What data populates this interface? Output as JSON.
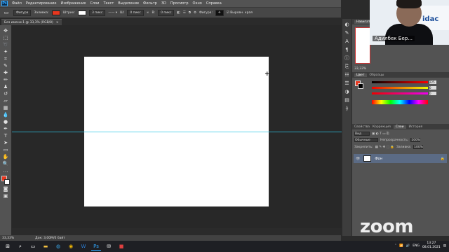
{
  "app": {
    "logo_text": "Ps",
    "menu": [
      "Файл",
      "Редактирование",
      "Изображение",
      "Слои",
      "Текст",
      "Выделение",
      "Фильтр",
      "3D",
      "Просмотр",
      "Окно",
      "Справка"
    ]
  },
  "options": {
    "shape_mode": "Фигура",
    "fill_label": "Заливка:",
    "stroke_label": "Штрих:",
    "stroke_width": "3 пикс",
    "w_label": "Ш:",
    "w_value": "0 пикс",
    "h_label": "В:",
    "h_value": "0 пикс",
    "align_edges": "Выровн. края",
    "fill_color": "#e8371f",
    "stroke_color": "#ffffff"
  },
  "document": {
    "tab_title": "Без имени-1 @ 33,3% (RGB/8)",
    "close": "×"
  },
  "status": {
    "zoom": "33,33%",
    "doc_info": "Док: 3,00M/0 байт"
  },
  "navigator": {
    "tab": "Навигатор",
    "zoom": "33,33%"
  },
  "color_panel": {
    "tabs": [
      "Цвет",
      "Образцы"
    ],
    "r": "225",
    "g": "0",
    "b": "0",
    "fg_color": "#e8371f"
  },
  "layers_panel": {
    "tabs": [
      "Свойства",
      "Коррекция",
      "Слои",
      "История"
    ],
    "kind_label": "Вид",
    "blend_mode": "Обычные",
    "opacity_label": "Непрозрачность:",
    "opacity_value": "100%",
    "lock_label": "Закрепить:",
    "fill_label": "Заливка:",
    "fill_value": "100%",
    "layer_name": "Фон",
    "lock_icon": "lock-icon"
  },
  "webcam": {
    "participant_name": "Адилбек Бер...",
    "background_text": "idac"
  },
  "zoom_watermark": "zoom",
  "taskbar": {
    "lang": "ENG",
    "time": "13:27",
    "date": "08.01.2021"
  }
}
